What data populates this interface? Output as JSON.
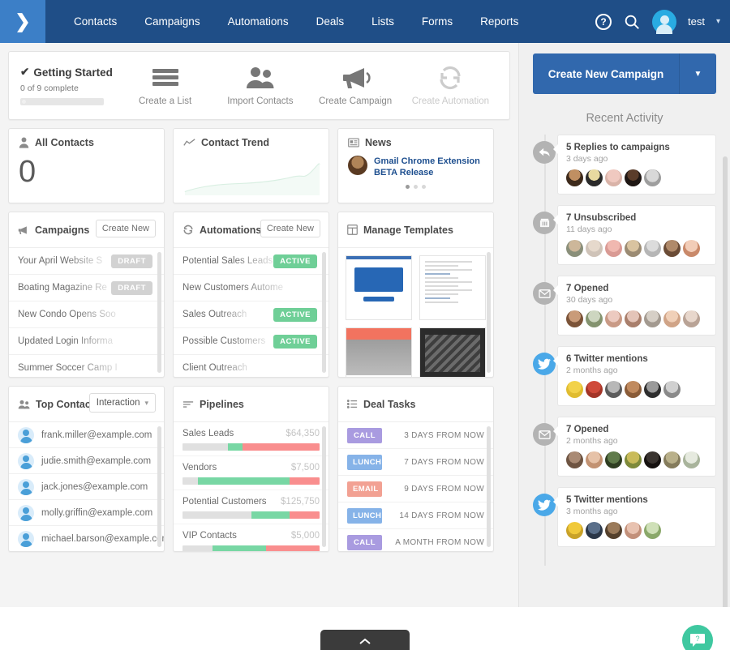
{
  "nav": {
    "logo_icon": "chevrons-right-icon",
    "items": [
      "Contacts",
      "Campaigns",
      "Automations",
      "Deals",
      "Lists",
      "Forms",
      "Reports"
    ],
    "help_icon": "question-circle-icon",
    "search_icon": "search-icon",
    "avatar_icon": "user-avatar-icon",
    "username": "test",
    "caret_icon": "chevron-down-icon"
  },
  "getting_started": {
    "check_icon": "check-icon",
    "title": "Getting Started",
    "progress_label": "0 of 9 complete",
    "progress_percent": 0,
    "steps": [
      {
        "label": "Create a List",
        "icon": "list-lines-icon",
        "faded": false
      },
      {
        "label": "Import Contacts",
        "icon": "two-people-icon",
        "faded": false
      },
      {
        "label": "Create Campaign",
        "icon": "megaphone-icon",
        "faded": false
      },
      {
        "label": "Create Automation",
        "icon": "refresh-cycle-icon",
        "faded": true
      }
    ]
  },
  "all_contacts": {
    "icon": "person-icon",
    "title": "All Contacts",
    "count": "0"
  },
  "contact_trend": {
    "icon": "trend-line-icon",
    "title": "Contact Trend",
    "line_color": "#dff0e6"
  },
  "news": {
    "icon": "news-card-icon",
    "title": "News",
    "headline": "Gmail Chrome Extension BETA Release",
    "dots": 3,
    "active_dot": 0
  },
  "campaigns": {
    "icon": "megaphone-icon",
    "title": "Campaigns",
    "create_label": "Create New",
    "rows": [
      {
        "name": "Your April Website S",
        "tag": "DRAFT",
        "tag_type": "draft"
      },
      {
        "name": "Boating Magazine Re",
        "tag": "DRAFT",
        "tag_type": "draft"
      },
      {
        "name": "New Condo Opens Soo",
        "tag": "",
        "tag_type": ""
      },
      {
        "name": "Updated Login Informa",
        "tag": "",
        "tag_type": ""
      },
      {
        "name": "Summer Soccer Camp I",
        "tag": "",
        "tag_type": ""
      }
    ]
  },
  "automations": {
    "icon": "refresh-cycle-icon",
    "title": "Automations",
    "create_label": "Create New",
    "rows": [
      {
        "name": "Potential Sales Leads",
        "tag": "ACTIVE",
        "tag_type": "active"
      },
      {
        "name": "New Customers Autome",
        "tag": "",
        "tag_type": ""
      },
      {
        "name": "Sales Outreach",
        "tag": "ACTIVE",
        "tag_type": "active"
      },
      {
        "name": "Possible Customers",
        "tag": "ACTIVE",
        "tag_type": "active"
      },
      {
        "name": "Client Outreach",
        "tag": "",
        "tag_type": ""
      }
    ]
  },
  "templates": {
    "icon": "template-grid-icon",
    "title": "Manage Templates",
    "items": [
      "template-screenshot-blue",
      "template-text-letter",
      "template-orange-banner",
      "template-dark-undercover"
    ]
  },
  "top_contacts": {
    "icon": "two-people-icon",
    "title": "Top Contacts",
    "filter_label": "Interaction",
    "filter_caret_icon": "chevron-down-icon",
    "rows": [
      "frank.miller@example.com",
      "judie.smith@example.com",
      "jack.jones@example.com",
      "molly.griffin@example.com",
      "michael.barson@example.com"
    ]
  },
  "pipelines": {
    "icon": "bars-sort-icon",
    "title": "Pipelines",
    "rows": [
      {
        "name": "Sales Leads",
        "amount": "$64,350",
        "grey": 33,
        "green": 11,
        "red": 56
      },
      {
        "name": "Vendors",
        "amount": "$7,500",
        "grey": 11,
        "green": 67,
        "red": 22
      },
      {
        "name": "Potential Customers",
        "amount": "$125,750",
        "grey": 50,
        "green": 28,
        "red": 22
      },
      {
        "name": "VIP Contacts",
        "amount": "$5,000",
        "grey": 22,
        "green": 39,
        "red": 39
      }
    ]
  },
  "deal_tasks": {
    "icon": "checklist-icon",
    "title": "Deal Tasks",
    "rows": [
      {
        "type": "CALL",
        "color": "#a99be0",
        "when": "3 DAYS FROM NOW"
      },
      {
        "type": "LUNCH",
        "color": "#86b3e8",
        "when": "7 DAYS FROM NOW"
      },
      {
        "type": "EMAIL",
        "color": "#f2a193",
        "when": "9 DAYS FROM NOW"
      },
      {
        "type": "LUNCH",
        "color": "#86b3e8",
        "when": "14 DAYS FROM NOW"
      },
      {
        "type": "CALL",
        "color": "#a99be0",
        "when": "A MONTH FROM NOW"
      }
    ]
  },
  "sidebar": {
    "cta_label": "Create New Campaign",
    "cta_caret_icon": "chevron-down-icon",
    "cta_color": "#3168ad",
    "activity_title": "Recent Activity",
    "events": [
      {
        "icon": "reply-arrow-icon",
        "icon_type": "grey",
        "title": "5 Replies to campaigns",
        "time": "3 days ago",
        "avatars": 5
      },
      {
        "icon": "unsubscribe-icon",
        "icon_type": "grey",
        "title": "7 Unsubscribed",
        "time": "11 days ago",
        "avatars": 7
      },
      {
        "icon": "envelope-icon",
        "icon_type": "grey",
        "title": "7 Opened",
        "time": "30 days ago",
        "avatars": 7
      },
      {
        "icon": "twitter-bird-icon",
        "icon_type": "twitter",
        "title": "6 Twitter mentions",
        "time": "2 months ago",
        "avatars": 6
      },
      {
        "icon": "envelope-icon",
        "icon_type": "grey",
        "title": "7 Opened",
        "time": "2 months ago",
        "avatars": 7
      },
      {
        "icon": "twitter-bird-icon",
        "icon_type": "twitter",
        "title": "5 Twitter mentions",
        "time": "3 months ago",
        "avatars": 5
      }
    ]
  },
  "footer": {
    "chat_icon": "help-chat-bubble-icon",
    "bottom_tab_icon": "chevron-up-icon"
  }
}
